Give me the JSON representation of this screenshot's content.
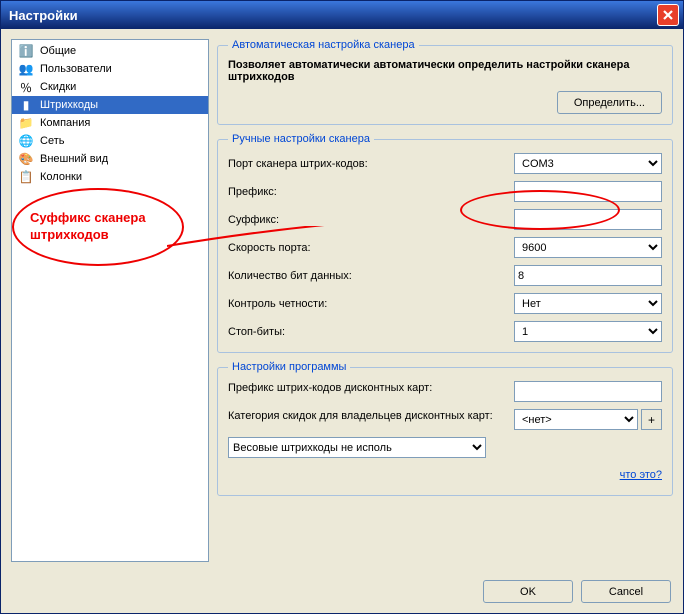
{
  "window": {
    "title": "Настройки"
  },
  "sidebar": {
    "items": [
      {
        "label": "Общие",
        "icon": "ℹ️"
      },
      {
        "label": "Пользователи",
        "icon": "👥"
      },
      {
        "label": "Скидки",
        "icon": "％"
      },
      {
        "label": "Штрихкоды",
        "icon": "▮"
      },
      {
        "label": "Компания",
        "icon": "📁"
      },
      {
        "label": "Сеть",
        "icon": "🌐"
      },
      {
        "label": "Внешний вид",
        "icon": "🎨"
      },
      {
        "label": "Колонки",
        "icon": "📋"
      }
    ]
  },
  "auto": {
    "legend": "Автоматическая настройка сканера",
    "desc": "Позволяет автоматически автоматически определить настройки сканера штрихкодов",
    "button": "Определить..."
  },
  "manual": {
    "legend": "Ручные настройки сканера",
    "port_label": "Порт сканера штрих-кодов:",
    "port_value": "COM3",
    "prefix_label": "Префикс:",
    "prefix_value": "",
    "suffix_label": "Суффикс:",
    "suffix_value": "",
    "speed_label": "Скорость порта:",
    "speed_value": "9600",
    "bits_label": "Количество бит данных:",
    "bits_value": "8",
    "parity_label": "Контроль четности:",
    "parity_value": "Нет",
    "stop_label": "Стоп-биты:",
    "stop_value": "1"
  },
  "program": {
    "legend": "Настройки программы",
    "dc_prefix_label": "Префикс штрих-кодов дисконтных карт:",
    "dc_prefix_value": "",
    "dc_cat_label": "Категория скидок для владельцев дисконтных карт:",
    "dc_cat_value": "<нет>",
    "plus": "+",
    "weight_value": "Весовые штрихкоды не исполь",
    "whatis": "что это?"
  },
  "footer": {
    "ok": "OK",
    "cancel": "Cancel"
  },
  "annotation": {
    "text1": "Суффикс сканера",
    "text2": "штрихкодов"
  }
}
